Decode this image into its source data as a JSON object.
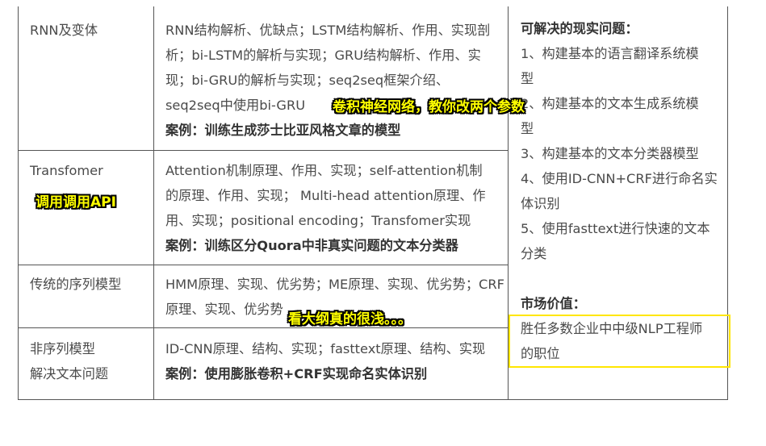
{
  "rows": [
    {
      "category": [
        "RNN及变体"
      ],
      "content": [
        "RNN结构解析、优缺点；LSTM结构解析、作用、实现剖",
        "析；bi-LSTM的解析与实现；GRU结构解析、作用、实",
        "现；bi-GRU的解析与实现；seq2seq框架介绍、",
        "seq2seq中使用bi-GRU"
      ],
      "case": "案例：训练生成莎士比亚风格文章的模型"
    },
    {
      "category": [
        "Transfomer"
      ],
      "content": [
        "Attention机制原理、作用、实现；self-attention机制",
        "的原理、作用、实现； Multi-head attention原理、作",
        "用、实现；positional encoding；Transfomer实现"
      ],
      "case": "案例：训练区分Quora中非真实问题的文本分类器"
    },
    {
      "category": [
        "传统的序列模型"
      ],
      "content": [
        "HMM原理、实现、优劣势；ME原理、实现、优劣势；CRF",
        "原理、实现、优劣势"
      ],
      "case": ""
    },
    {
      "category": [
        "非序列模型",
        "解决文本问题"
      ],
      "content": [
        "ID-CNN原理、结构、实现；fasttext原理、结构、实现"
      ],
      "case": "案例：使用膨胀卷积+CRF实现命名实体识别"
    }
  ],
  "right": {
    "problems_heading": "可解决的现实问题：",
    "problems": [
      "1、构建基本的语言翻译系统模",
      "型",
      "2、构建基本的文本生成系统模",
      "型",
      "3、构建基本的文本分类器模型",
      "4、使用ID-CNN+CRF进行命名实",
      "体识别",
      "5、使用fasttext进行快速的文本",
      "分类"
    ],
    "value_heading": "市场价值：",
    "value": [
      "胜任多数企业中中级NLP工程师",
      "的职位"
    ]
  },
  "overlays": {
    "top": "卷积神经网络，教你改两个参数",
    "middle_left": "调用调用API",
    "bottom": "看大纲真的很浅。。。"
  },
  "colors": {
    "overlay_text": "#ffff00",
    "highlight_border": "#ffe600"
  }
}
